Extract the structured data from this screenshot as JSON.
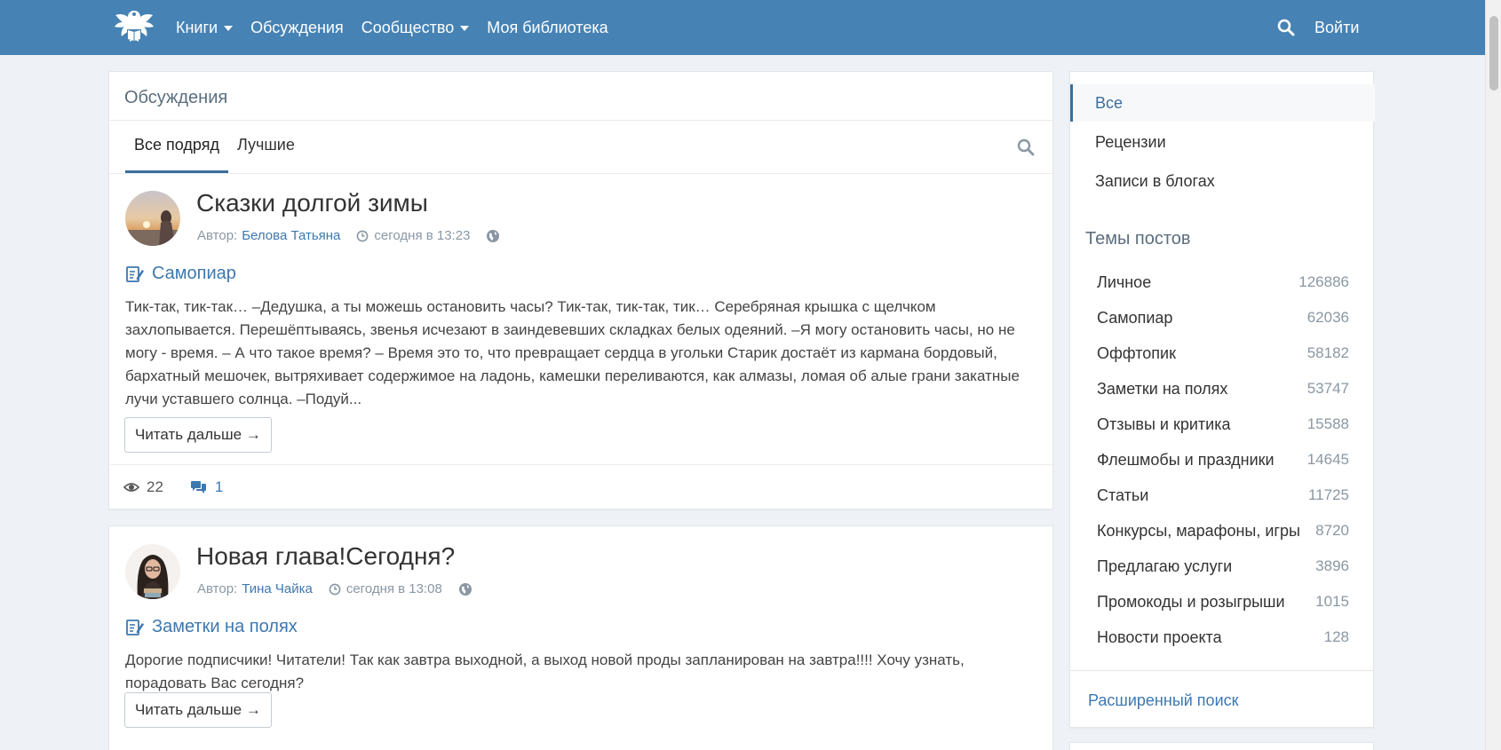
{
  "header": {
    "logo_icon": "eagle-book-logo-icon",
    "nav": [
      {
        "label": "Книги",
        "dropdown": true
      },
      {
        "label": "Обсуждения",
        "dropdown": false
      },
      {
        "label": "Сообщество",
        "dropdown": true
      },
      {
        "label": "Моя библиотека",
        "dropdown": false
      }
    ],
    "search_icon": "search-icon",
    "login_label": "Войти",
    "bg_color": "#4682b4"
  },
  "main": {
    "title": "Обсуждения",
    "tabs": [
      {
        "label": "Все подряд",
        "active": true
      },
      {
        "label": "Лучшие",
        "active": false
      }
    ],
    "posts": [
      {
        "title": "Сказки долгой зимы",
        "author_prefix": "Автор:",
        "author": "Белова Татьяна",
        "time": "сегодня в 13:23",
        "category": "Самопиар",
        "excerpt": "Тик-так, тик-так… –Дедушка, а ты можешь остановить часы? Тик-так, тик-так, тик… Серебряная крышка с щелчком захлопывается. Перешёптываясь, звенья исчезают в заиндевевших складках белых одеяний. –Я могу остановить часы, но не могу - время. – А что такое время? – Время это то, что превращает сердца в угольки Старик достаёт из кармана бордовый, бархатный мешочек, вытряхивает содержимое на ладонь, камешки переливаются, как алмазы, ломая об алые грани закатные лучи уставшего солнца. –Подуй...",
        "read_more": "Читать дальше →",
        "views": "22",
        "comments": "1"
      },
      {
        "title": "Новая глава!Сегодня?",
        "author_prefix": "Автор:",
        "author": "Тина Чайка",
        "time": "сегодня в 13:08",
        "category": "Заметки на полях",
        "excerpt": "Дорогие подписчики! Читатели! Так как завтра выходной, а выход новой проды запланирован на завтра!!!! Хочу узнать, порадовать Вас сегодня?",
        "read_more": "Читать дальше →"
      }
    ]
  },
  "sidebar": {
    "menu": [
      {
        "label": "Все",
        "active": true
      },
      {
        "label": "Рецензии",
        "active": false
      },
      {
        "label": "Записи в блогах",
        "active": false
      }
    ],
    "topics_heading": "Темы постов",
    "topics": [
      {
        "name": "Личное",
        "count": "126886"
      },
      {
        "name": "Самопиар",
        "count": "62036"
      },
      {
        "name": "Оффтопик",
        "count": "58182"
      },
      {
        "name": "Заметки на полях",
        "count": "53747"
      },
      {
        "name": "Отзывы и критика",
        "count": "15588"
      },
      {
        "name": "Флешмобы и праздники",
        "count": "14645"
      },
      {
        "name": "Статьи",
        "count": "11725"
      },
      {
        "name": "Конкурсы, марафоны, игры",
        "count": "8720"
      },
      {
        "name": "Предлагаю услуги",
        "count": "3896"
      },
      {
        "name": "Промокоды и розыгрыши",
        "count": "1015"
      },
      {
        "name": "Новости проекта",
        "count": "128"
      }
    ],
    "advanced_search": "Расширенный поиск"
  },
  "colors": {
    "accent": "#3d78b0",
    "header": "#4682b4",
    "background": "#eef2f6"
  }
}
